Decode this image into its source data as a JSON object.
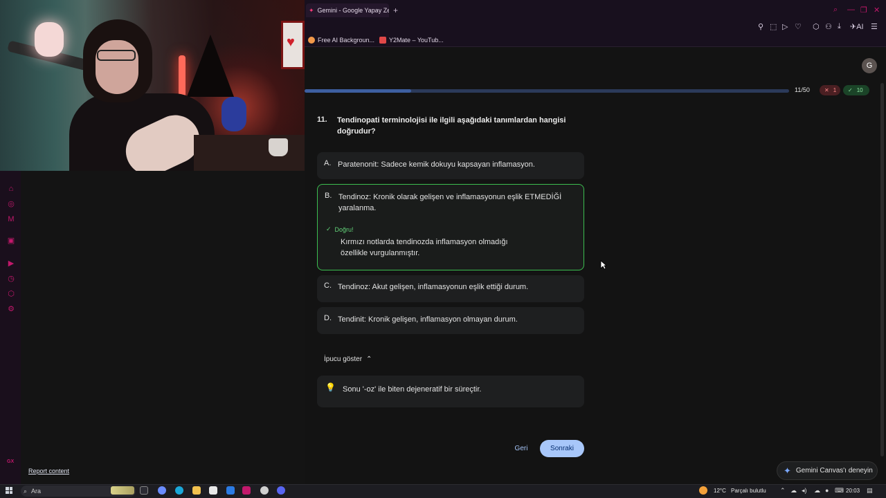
{
  "browser": {
    "tab_title": "Gemini - Google Yapay Zeka",
    "new_tab": "+",
    "bookmarks": [
      {
        "label": "Free AI Backgroun...",
        "color": "#f2994a"
      },
      {
        "label": "Y2Mate – YouTub...",
        "color": "#e04848"
      }
    ],
    "toolbar_ai_label": "AI"
  },
  "webcam": {
    "heart": "♥"
  },
  "left_panel": {
    "report_link": "Report content",
    "gx_label": "GX"
  },
  "quiz": {
    "progress_text": "11/50",
    "progress_fraction": 0.22,
    "wrong_count": "1",
    "right_count": "10",
    "wrong_symbol": "✕",
    "right_symbol": "✓",
    "question_number": "11.",
    "question_text": "Tendinopati terminolojisi ile ilgili aşağıdaki tanımlardan hangisi doğrudur?",
    "options": [
      {
        "letter": "A.",
        "text": "Paratenonit: Sadece kemik dokuyu kapsayan inflamasyon."
      },
      {
        "letter": "B.",
        "text": "Tendinoz: Kronik olarak gelişen ve inflamasyonun eşlik ETMEDİĞİ yaralanma."
      },
      {
        "letter": "C.",
        "text": "Tendinoz: Akut gelişen, inflamasyonun eşlik ettiği durum."
      },
      {
        "letter": "D.",
        "text": "Tendinit: Kronik gelişen, inflamasyon olmayan durum."
      }
    ],
    "correct_label": "Doğru!",
    "explanation": "Kırmızı notlarda tendinozda inflamasyon olmadığı özellikle vurgulanmıştır.",
    "hint_toggle": "İpucu göster",
    "hint_text": "Sonu '-oz' ile biten dejeneratif bir süreçtir.",
    "back_button": "Geri",
    "next_button": "Sonraki"
  },
  "user": {
    "avatar_letter": "G"
  },
  "canvas_cta": "Gemini Canvas'ı deneyin",
  "taskbar": {
    "search_placeholder": "Ara",
    "weather_temp": "12°C",
    "weather_desc": "Parçalı bulutlu",
    "time": "20:03"
  },
  "colors": {
    "accent": "#a8c7fa",
    "correct": "#3cbf50",
    "wrong": "#ff8a8a",
    "opera_red": "#c2186b"
  }
}
